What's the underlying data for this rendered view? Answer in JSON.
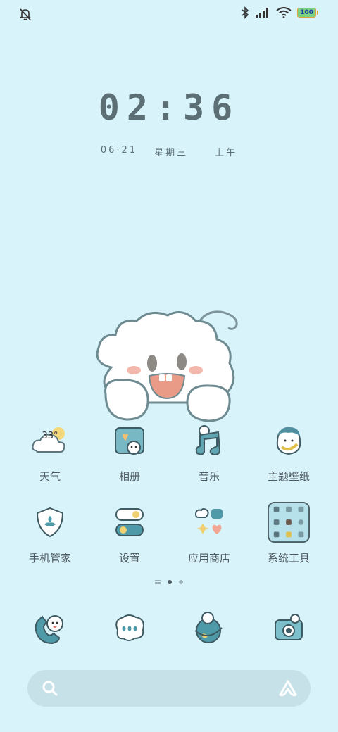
{
  "status_bar": {
    "battery": "100",
    "icons": [
      "mute-bell-icon",
      "bluetooth-icon",
      "signal-icon",
      "wifi-icon",
      "battery-icon"
    ]
  },
  "clock": {
    "time": "02:36",
    "date": "06·21",
    "weekday": "星期三",
    "period": "上午"
  },
  "apps": [
    {
      "label": "天气",
      "icon": "weather-icon",
      "temp": "33°"
    },
    {
      "label": "相册",
      "icon": "gallery-icon"
    },
    {
      "label": "音乐",
      "icon": "music-icon"
    },
    {
      "label": "主题壁纸",
      "icon": "themes-icon"
    },
    {
      "label": "手机管家",
      "icon": "security-icon"
    },
    {
      "label": "设置",
      "icon": "settings-icon"
    },
    {
      "label": "应用商店",
      "icon": "app-store-icon"
    },
    {
      "label": "系统工具",
      "icon": "system-tools-folder-icon"
    }
  ],
  "dock": [
    {
      "icon": "phone-icon"
    },
    {
      "icon": "messages-icon"
    },
    {
      "icon": "browser-icon"
    },
    {
      "icon": "camera-icon"
    }
  ],
  "pager": {
    "pages": 2,
    "active": 0
  },
  "search": {
    "icons": [
      "search-icon",
      "assistant-icon"
    ]
  },
  "colors": {
    "background": "#d9f3fb",
    "accent_teal": "#4f9aa8",
    "search_bar": "#c6e2e8",
    "text": "#4d5960"
  }
}
